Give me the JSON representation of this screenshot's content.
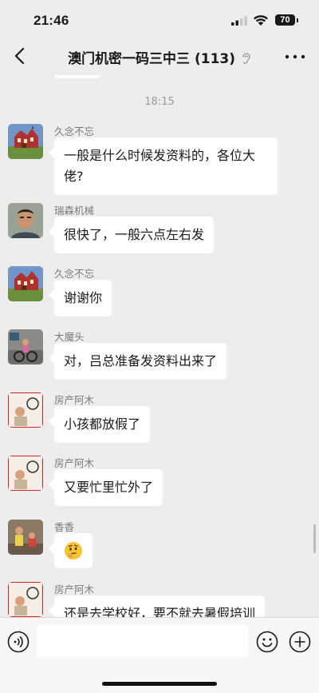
{
  "status_bar": {
    "time": "21:46",
    "battery": "70"
  },
  "header": {
    "title": "澳门机密一码三中三 (113)"
  },
  "timestamp": "18:15",
  "messages": [
    {
      "sender": "久念不忘",
      "text": "一般是什么时候发资料的，各位大佬?",
      "avatar": "house-avatar"
    },
    {
      "sender": "瑞森机械",
      "text": "很快了，一般六点左右发",
      "avatar": "man-avatar"
    },
    {
      "sender": "久念不忘",
      "text": "谢谢你",
      "avatar": "house-avatar"
    },
    {
      "sender": "大魔头",
      "text": "对，吕总准备发资料出来了",
      "avatar": "child-bike-avatar"
    },
    {
      "sender": "房产阿木",
      "text": "小孩都放假了",
      "avatar": "child-photo-avatar"
    },
    {
      "sender": "房产阿木",
      "text": "又要忙里忙外了",
      "avatar": "child-photo-avatar"
    },
    {
      "sender": "香香",
      "text": "",
      "emoji": "thinking-face-emoji",
      "avatar": "kids-avatar"
    },
    {
      "sender": "房产阿木",
      "text": "还是去学校好，要不就去暑假培训",
      "avatar": "child-photo-avatar"
    }
  ],
  "input": {
    "placeholder": ""
  },
  "icons": [
    "back-icon",
    "ear-icon",
    "more-icon",
    "voice-icon",
    "emoji-icon",
    "plus-icon"
  ],
  "colors": {
    "background": "#ededed",
    "bubble": "#ffffff",
    "sender": "#7b7b7b"
  }
}
